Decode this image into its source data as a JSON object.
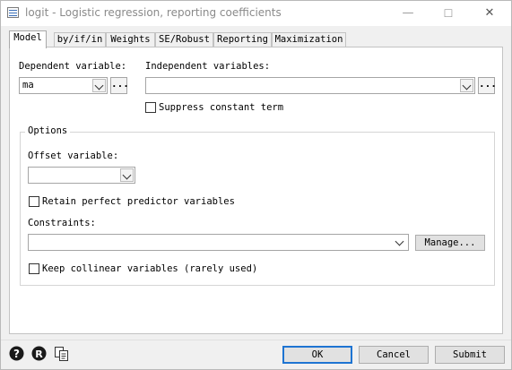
{
  "window": {
    "title": "logit - Logistic regression, reporting coefficients",
    "controls": {
      "minimize": "—",
      "maximize": "☐",
      "close": "✕"
    }
  },
  "tabs": [
    {
      "label": "Model"
    },
    {
      "label": "by/if/in"
    },
    {
      "label": "Weights"
    },
    {
      "label": "SE/Robust"
    },
    {
      "label": "Reporting"
    },
    {
      "label": "Maximization"
    }
  ],
  "model": {
    "dependent_label": "Dependent variable:",
    "dependent_value": "ma",
    "independent_label": "Independent variables:",
    "independent_value": "",
    "browse_label": "...",
    "suppress_constant_label": "Suppress constant term"
  },
  "options": {
    "group_label": "Options",
    "offset_label": "Offset variable:",
    "offset_value": "",
    "retain_label": "Retain perfect predictor variables",
    "constraints_label": "Constraints:",
    "constraints_value": "",
    "manage_label": "Manage...",
    "collinear_label": "Keep collinear variables (rarely used)"
  },
  "footer": {
    "ok_label": "OK",
    "cancel_label": "Cancel",
    "submit_label": "Submit"
  },
  "icons": {
    "help": "help-icon",
    "reset": "reset-icon",
    "copy": "copy-command-icon"
  }
}
